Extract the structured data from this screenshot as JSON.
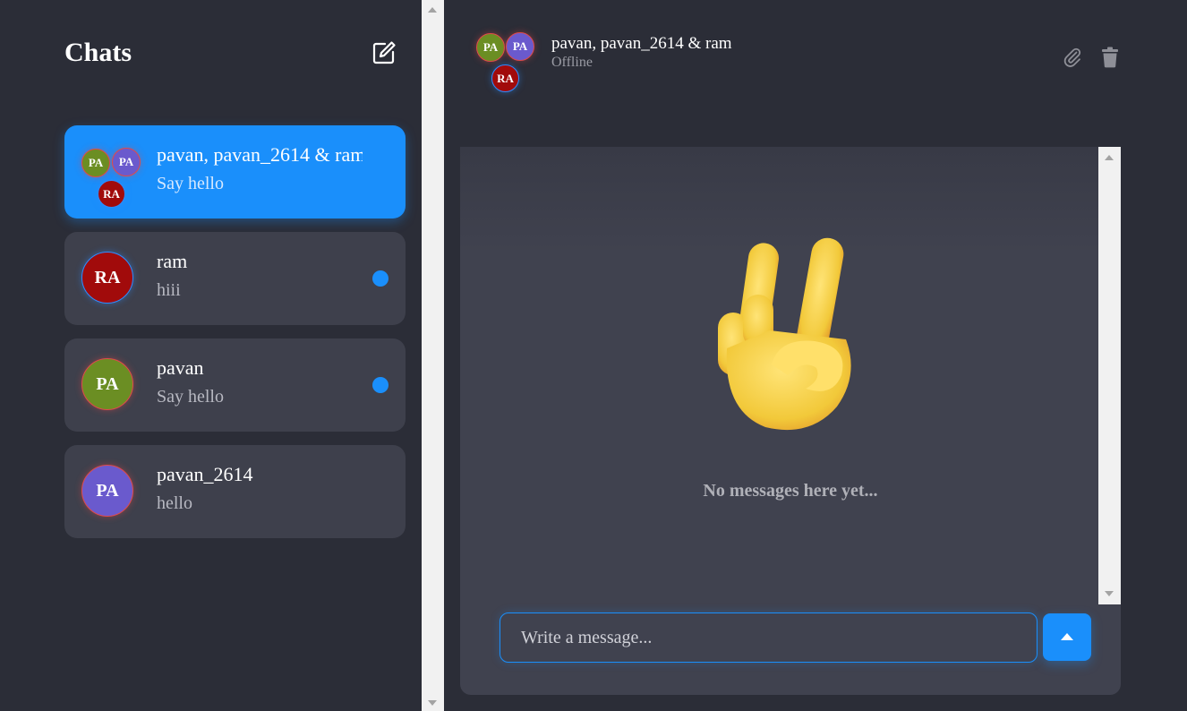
{
  "sidebar": {
    "title": "Chats",
    "chats": [
      {
        "name": "pavan, pavan_2614 & ram",
        "preview": "Say hello",
        "avatars": [
          "PA",
          "PA",
          "RA"
        ],
        "active": true,
        "unread": false
      },
      {
        "name": "ram",
        "preview": "hiii",
        "avatar": "RA",
        "unread": true
      },
      {
        "name": "pavan",
        "preview": "Say hello",
        "avatar": "PA",
        "unread": true
      },
      {
        "name": "pavan_2614",
        "preview": "hello",
        "avatar": "PA",
        "unread": false
      }
    ]
  },
  "header": {
    "name": "pavan, pavan_2614 & ram",
    "status": "Offline",
    "avatars": [
      "PA",
      "PA",
      "RA"
    ],
    "icons": [
      "paperclip-icon",
      "trash-icon"
    ]
  },
  "conversation": {
    "empty_text": "No messages here yet...",
    "graphic": "victory-hand-emoji"
  },
  "composer": {
    "placeholder": "Write a message..."
  },
  "colors": {
    "accent": "#1a8ffb",
    "background": "#2b2d37",
    "card": "#3e404c",
    "avatar_green": "#6b8e23",
    "avatar_purple": "#6a5acd",
    "avatar_red": "#a10b0b"
  }
}
